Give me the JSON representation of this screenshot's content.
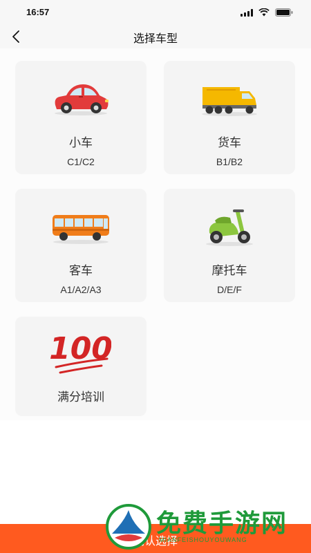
{
  "status": {
    "time": "16:57"
  },
  "nav": {
    "title": "选择车型"
  },
  "cards": [
    {
      "name": "小车",
      "code": "C1/C2",
      "icon": "car-icon"
    },
    {
      "name": "货车",
      "code": "B1/B2",
      "icon": "truck-icon"
    },
    {
      "name": "客车",
      "code": "A1/A2/A3",
      "icon": "bus-icon"
    },
    {
      "name": "摩托车",
      "code": "D/E/F",
      "icon": "scooter-icon"
    },
    {
      "name": "满分培训",
      "icon": "hundred-icon",
      "badge": "100"
    }
  ],
  "bottom": {
    "label": "确认选择"
  },
  "watermark": {
    "title": "免费手游网",
    "subtitle": "MIANFEISHOUYOUWANG"
  },
  "colors": {
    "accent": "#ff5a1f",
    "card_bg": "#f4f4f4",
    "watermark": "#1f9a3a"
  }
}
